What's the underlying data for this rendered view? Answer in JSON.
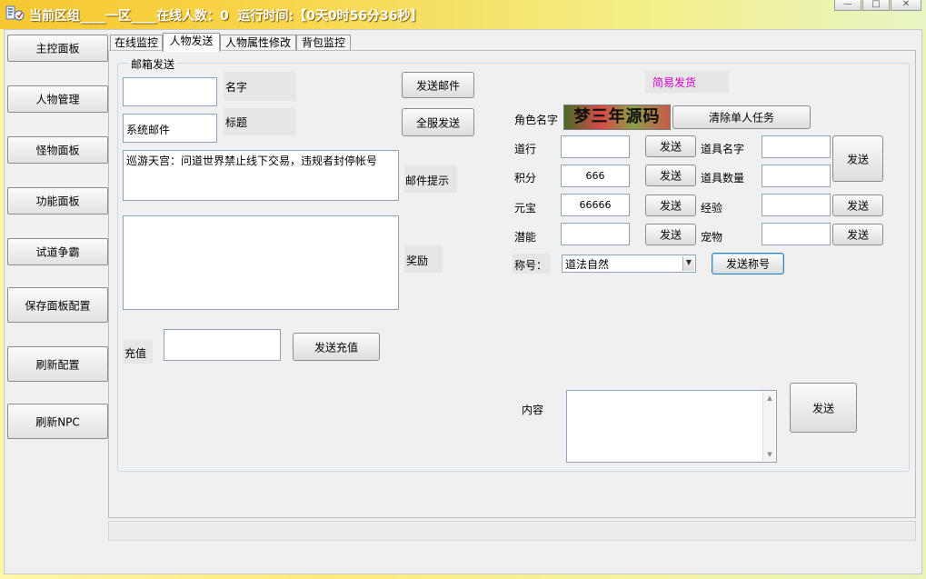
{
  "window": {
    "title": "当前区组____一区____在线人数：0  运行时间:【0天0时56分36秒】",
    "controls": {
      "minimize": "—",
      "maximize": "□",
      "close": "✕"
    }
  },
  "nav": [
    "主控面板",
    "人物管理",
    "怪物面板",
    "功能面板",
    "试道争霸",
    "保存面板配置",
    "刷新配置",
    "刷新NPC"
  ],
  "tabs": [
    "在线监控",
    "人物发送",
    "人物属性修改",
    "背包监控"
  ],
  "mail": {
    "group_title": "邮箱发送",
    "name_label": "名字",
    "name_value": "",
    "title_label": "标题",
    "title_value": "系统邮件",
    "send_mail_button": "发送邮件",
    "send_all_button": "全服发送",
    "tip_label": "邮件提示",
    "tip_value": "巡游天宫：问道世界禁止线下交易，违规者封停帐号",
    "reward_label": "奖励",
    "reward_value": "",
    "recharge_label": "充值",
    "recharge_value": "",
    "recharge_button": "发送充值"
  },
  "easy": {
    "title": "简易发货",
    "title_color": "#d000d0",
    "role_label": "角色名字",
    "banner_text": "梦三年源码",
    "clear_task_button": "清除单人任务",
    "daoxing_label": "道行",
    "daoxing_value": "",
    "jifen_label": "积分",
    "jifen_value": "666",
    "yuanbao_label": "元宝",
    "yuanbao_value": "66666",
    "qianneng_label": "潜能",
    "qianneng_value": "",
    "send_label": "发送",
    "item_name_label": "道具名字",
    "item_name_value": "",
    "item_count_label": "道具数量",
    "item_count_value": "",
    "exp_label": "经验",
    "exp_value": "",
    "pet_label": "宠物",
    "pet_value": "",
    "title_field_label": "称号：",
    "title_select_value": "道法自然",
    "send_title_button": "发送称号",
    "content_label": "内容",
    "content_value": "",
    "content_send_button": "发送"
  }
}
